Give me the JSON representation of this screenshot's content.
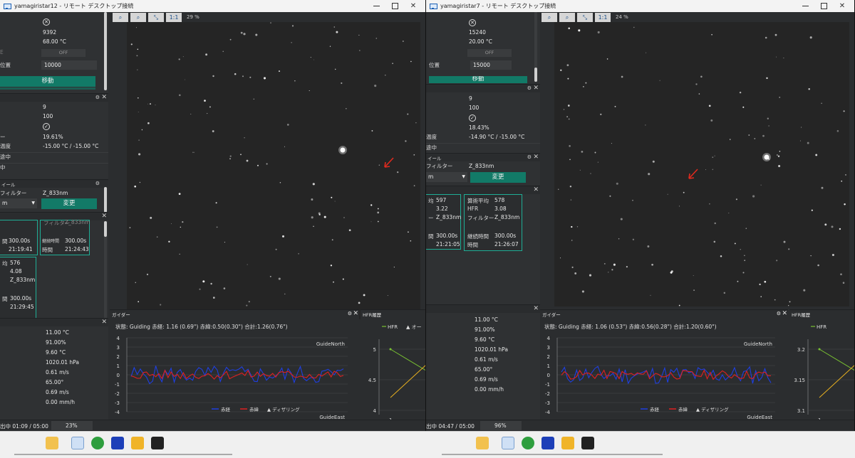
{
  "left_window": {
    "title": "yamagiristar12 - リモート デスクトップ接続",
    "focuser": {
      "value1": "9392",
      "temp": "68.00 °C",
      "toggle": "OFF",
      "pos_label": "位置",
      "pos_value": "10000",
      "move_btn": "移動"
    },
    "camera": {
      "rows": [
        {
          "label": "",
          "value": "9"
        },
        {
          "label": "",
          "value": "100"
        },
        {
          "label": "",
          "value": ""
        },
        {
          "label": "ー",
          "value": "19.61%"
        },
        {
          "label": "温度",
          "value": "-15.00 °C / -15.00 °C"
        },
        {
          "label": "途中",
          "value": ""
        },
        {
          "label": "中",
          "value": ""
        }
      ]
    },
    "filter": {
      "header": "イール",
      "label": "フィルター",
      "value": "Z_833nm",
      "select": "m",
      "change_btn": "変更"
    },
    "cards": [
      {
        "rows": [
          [
            "間",
            "300.00s"
          ],
          [
            "",
            "21:19:41"
          ]
        ]
      },
      {
        "rows": [
          [
            "継続時間",
            "300.00s"
          ],
          [
            "時間",
            "21:24:43"
          ]
        ],
        "top": [
          "フィルター",
          "Z_833nm"
        ]
      },
      {
        "rows": [
          [
            "均",
            "576"
          ],
          [
            "",
            "4.08"
          ],
          [
            "",
            "Z_833nm"
          ],
          [
            "間",
            "300.00s"
          ],
          [
            "",
            "21:29:45"
          ]
        ]
      }
    ],
    "toolbar_zoom": "29 %",
    "guider": {
      "title": "ガイダー",
      "status": "状態: Guiding 赤経: 1.16 (0.69\") 赤緯:0.50(0.30\") 合計:1.26(0.76\")",
      "north": "GuideNorth",
      "east": "GuideEast",
      "legend_ra": "赤経",
      "legend_dec": "赤緯",
      "legend_dither": "ディザリング",
      "yticks": [
        "4",
        "3",
        "2",
        "1",
        "0",
        "-1",
        "-2",
        "-3",
        "-4"
      ]
    },
    "hfr": {
      "title": "HFR履歴",
      "legend": "HFR",
      "legend2": "オー",
      "yticks": [
        "5",
        "4.5",
        "4"
      ],
      "xtick": "1"
    },
    "weather": [
      "11.00 °C",
      "91.00%",
      "9.60 °C",
      "1020.01 hPa",
      "0.61 m/s",
      "65.00°",
      "0.69 m/s",
      "0.00 mm/h"
    ],
    "exposure": "出中 01:09 / 05:00",
    "progress": "23%"
  },
  "right_window": {
    "title": "yamagiristar7 - リモート デスクトップ接続",
    "focuser": {
      "value1": "15240",
      "temp": "20.00 °C",
      "toggle": "OFF",
      "pos_label": "位置",
      "pos_value": "15000",
      "move_btn": "移動"
    },
    "camera": {
      "rows": [
        {
          "label": "",
          "value": "9"
        },
        {
          "label": "",
          "value": "100"
        },
        {
          "label": "",
          "value": ""
        },
        {
          "label": "",
          "value": "18.43%"
        },
        {
          "label": "温度",
          "value": "-14.90 °C / -15.00 °C"
        },
        {
          "label": "途中",
          "value": ""
        }
      ]
    },
    "filter": {
      "header": "イール",
      "label": "フィルター",
      "value": "Z_833nm",
      "select": "m",
      "change_btn": "変更"
    },
    "cards": [
      {
        "rows": [
          [
            "均",
            "597"
          ],
          [
            "",
            "3.22"
          ],
          [
            "ー",
            "Z_833nm"
          ],
          [
            "間",
            "300.00s"
          ],
          [
            "",
            "21:21:05"
          ]
        ]
      },
      {
        "rows": [
          [
            "算術平均",
            "578"
          ],
          [
            "HFR",
            "3.08"
          ],
          [
            "フィルター",
            "Z_833nm"
          ],
          [
            "継続時間",
            "300.00s"
          ],
          [
            "時間",
            "21:26:07"
          ]
        ]
      }
    ],
    "toolbar_zoom": "24 %",
    "guider": {
      "title": "ガイダー",
      "status": "状態: Guiding 赤経: 1.06 (0.53\") 赤緯:0.56(0.28\") 合計:1.20(0.60\")",
      "north": "GuideNorth",
      "east": "GuideEast",
      "legend_ra": "赤経",
      "legend_dec": "赤緯",
      "legend_dither": "ディザリング",
      "yticks": [
        "4",
        "3",
        "2",
        "1",
        "0",
        "-1",
        "-2",
        "-3",
        "-4"
      ]
    },
    "hfr": {
      "title": "HFR履歴",
      "legend": "HFR",
      "yticks": [
        "3.2",
        "3.15",
        "3.1"
      ],
      "xtick": "1"
    },
    "weather": [
      "11.00 °C",
      "91.00%",
      "9.60 °C",
      "1020.01 hPa",
      "0.61 m/s",
      "65.00°",
      "0.69 m/s",
      "0.00 mm/h"
    ],
    "exposure": "出中 04:47 / 05:00",
    "progress": "96%"
  },
  "colors": {
    "accent": "#127a67",
    "card_border": "#1fae96",
    "ra_line": "#1f3fe0",
    "dec_line": "#e02020",
    "hfr_green": "#7ac232",
    "hfr_orange": "#e8b020",
    "arrow": "#e02a1e"
  }
}
